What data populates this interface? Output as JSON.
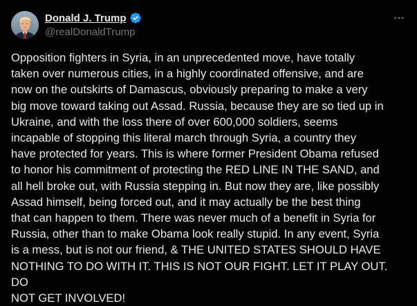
{
  "author": {
    "display_name": "Donald J. Trump",
    "handle": "@realDonaldTrump",
    "verified_icon": "verified-badge-icon",
    "avatar_icon": "profile-photo"
  },
  "post": {
    "text": "Opposition fighters in Syria, in an unprecedented move, have totally\ntaken over numerous cities, in a highly coordinated offensive, and are\nnow on the outskirts of Damascus, obviously preparing to make a very\nbig move toward taking out Assad. Russia, because they are so tied up in\nUkraine, and with the loss there of over 600,000 soldiers, seems\nincapable of stopping this literal march through Syria, a country they\nhave protected for years. This is where former President Obama refused\nto honor his commitment of protecting the RED LINE IN THE SAND, and\nall hell broke out, with Russia stepping in. But now they are, like possibly\nAssad himself, being forced out, and it may actually be the best thing\nthat can happen to them. There was never much of a benefit in Syria for\nRussia, other than to make Obama look really stupid. In any event, Syria\nis a mess, but is not our friend, & THE UNITED STATES SHOULD HAVE\nNOTHING TO DO WITH IT. THIS IS NOT OUR FIGHT. LET IT PLAY OUT. DO\nNOT GET INVOLVED!"
  },
  "toolbar": {
    "more_icon": "more-options-icon"
  },
  "colors": {
    "background": "#000000",
    "text": "#e7e9ea",
    "secondary_text": "#71767b",
    "verified_blue": "#1d9bf0"
  }
}
